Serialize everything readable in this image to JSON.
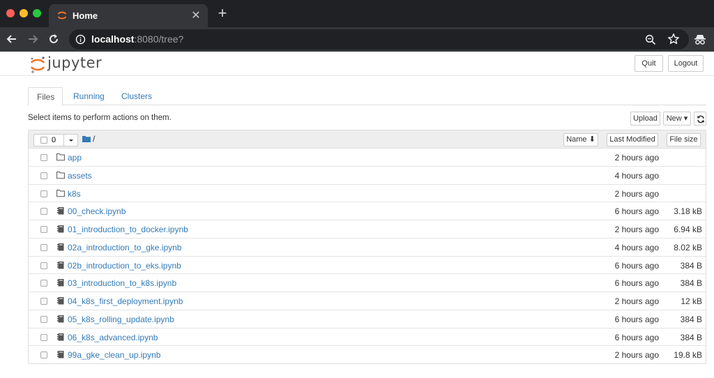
{
  "browser": {
    "tab_title": "Home",
    "close_glyph": "✕",
    "new_tab_glyph": "+",
    "url_host": "localhost",
    "url_path": ":8080/tree?"
  },
  "header": {
    "wordmark": "jupyter",
    "quit_label": "Quit",
    "logout_label": "Logout"
  },
  "tabs": [
    {
      "label": "Files"
    },
    {
      "label": "Running"
    },
    {
      "label": "Clusters"
    }
  ],
  "toolbar": {
    "instructions": "Select items to perform actions on them.",
    "upload_label": "Upload",
    "new_label": "New ▾"
  },
  "list_header": {
    "selected_count": "0",
    "root_path": "/",
    "sort_name": "Name ⬇",
    "sort_modified": "Last Modified",
    "sort_size": "File size"
  },
  "files": [
    {
      "name": "app",
      "type": "folder",
      "modified": "2 hours ago",
      "size": ""
    },
    {
      "name": "assets",
      "type": "folder",
      "modified": "4 hours ago",
      "size": ""
    },
    {
      "name": "k8s",
      "type": "folder",
      "modified": "2 hours ago",
      "size": ""
    },
    {
      "name": "00_check.ipynb",
      "type": "notebook",
      "modified": "6 hours ago",
      "size": "3.18 kB"
    },
    {
      "name": "01_introduction_to_docker.ipynb",
      "type": "notebook",
      "modified": "2 hours ago",
      "size": "6.94 kB"
    },
    {
      "name": "02a_introduction_to_gke.ipynb",
      "type": "notebook",
      "modified": "4 hours ago",
      "size": "8.02 kB"
    },
    {
      "name": "02b_introduction_to_eks.ipynb",
      "type": "notebook",
      "modified": "6 hours ago",
      "size": "384 B"
    },
    {
      "name": "03_introduction_to_k8s.ipynb",
      "type": "notebook",
      "modified": "6 hours ago",
      "size": "384 B"
    },
    {
      "name": "04_k8s_first_deployment.ipynb",
      "type": "notebook",
      "modified": "2 hours ago",
      "size": "12 kB"
    },
    {
      "name": "05_k8s_rolling_update.ipynb",
      "type": "notebook",
      "modified": "6 hours ago",
      "size": "384 B"
    },
    {
      "name": "06_k8s_advanced.ipynb",
      "type": "notebook",
      "modified": "6 hours ago",
      "size": "384 B"
    },
    {
      "name": "99a_gke_clean_up.ipynb",
      "type": "notebook",
      "modified": "2 hours ago",
      "size": "19.8 kB"
    }
  ],
  "colors": {
    "link": "#337ab7",
    "jupyter_orange": "#f37726",
    "chrome_dark": "#202124"
  }
}
